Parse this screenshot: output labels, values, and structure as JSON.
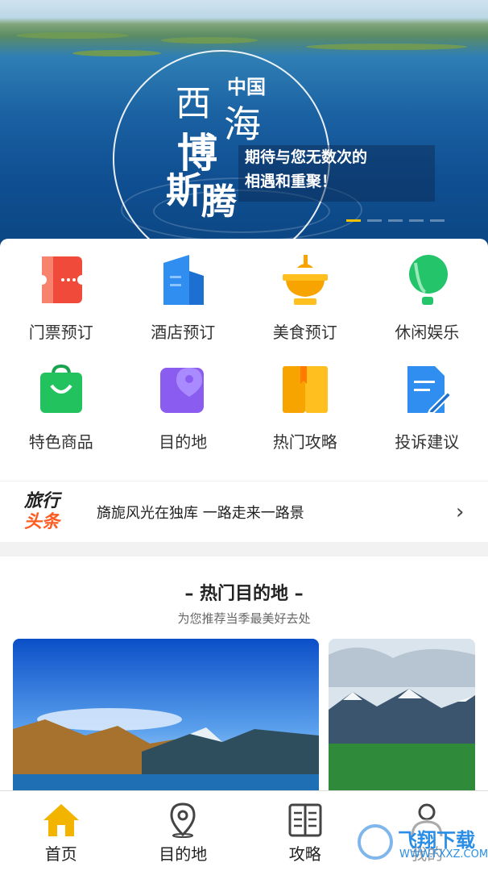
{
  "banner": {
    "char_xi": "西",
    "char_zhongguo": "中国",
    "char_hai": "海",
    "char_bo": "博",
    "char_si": "斯",
    "char_teng": "腾",
    "slogan_line1": "期待与您无数次的",
    "slogan_line2": "相遇和重聚！",
    "active_dot": 0
  },
  "categories": [
    {
      "label": "门票预订",
      "icon": "ticket-icon",
      "color": "#f04a3a"
    },
    {
      "label": "酒店预订",
      "icon": "hotel-icon",
      "color": "#2f8ef0"
    },
    {
      "label": "美食预订",
      "icon": "hotpot-icon",
      "color": "#f7a300"
    },
    {
      "label": "休闲娱乐",
      "icon": "balloon-icon",
      "color": "#23c46a"
    },
    {
      "label": "特色商品",
      "icon": "shopping-bag-icon",
      "color": "#22c25f"
    },
    {
      "label": "目的地",
      "icon": "map-pin-icon",
      "color": "#8a5cf0"
    },
    {
      "label": "热门攻略",
      "icon": "book-icon",
      "color": "#f7a300"
    },
    {
      "label": "投诉建议",
      "icon": "edit-document-icon",
      "color": "#2f8ef0"
    }
  ],
  "news": {
    "logo_line1": "旅行",
    "logo_line2": "头条",
    "headline": "旖旎风光在独库 一路走来一路景",
    "chevron": "›"
  },
  "hot": {
    "title": "– 热门目的地 –",
    "subtitle": "为您推荐当季最美好去处"
  },
  "tabs": [
    {
      "label": "首页",
      "icon": "home-icon",
      "active": true
    },
    {
      "label": "目的地",
      "icon": "location-pin-icon",
      "active": false
    },
    {
      "label": "攻略",
      "icon": "guide-book-icon",
      "active": false
    },
    {
      "label": "我的",
      "icon": "user-icon",
      "active": false
    }
  ],
  "watermark": {
    "line1": "飞翔下载",
    "line2": "WWW.FXXZ.COM"
  },
  "colors": {
    "accent": "#f3b400",
    "news_orange": "#ff5a1f"
  }
}
